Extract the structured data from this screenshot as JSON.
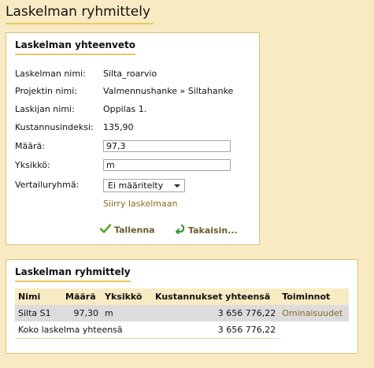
{
  "page": {
    "title": "Laskelman ryhmittely"
  },
  "summary": {
    "title": "Laskelman yhteenveto",
    "fields": {
      "name": {
        "label": "Laskelman nimi:",
        "value": "Silta_roarvio"
      },
      "project": {
        "label": "Projektin nimi:",
        "value": "Valmennushanke » Siltahanke"
      },
      "calculator": {
        "label": "Laskijan nimi:",
        "value": "Oppilas 1."
      },
      "index": {
        "label": "Kustannusindeksi:",
        "value": "135,90"
      },
      "amount": {
        "label": "Määrä:",
        "value": "97,3"
      },
      "unit": {
        "label": "Yksikkö:",
        "value": "m"
      },
      "group": {
        "label": "Vertailuryhmä:",
        "value": "Ei määritelty"
      }
    },
    "goto_link": "Siirry laskelmaan",
    "save_label": "Tallenna",
    "back_label": "Takaisin..."
  },
  "grouping": {
    "title": "Laskelman ryhmittely",
    "headers": {
      "name": "Nimi",
      "amount": "Määrä",
      "unit": "Yksikkö",
      "total": "Kustannukset yhteensä",
      "actions": "Toiminnot"
    },
    "rows": [
      {
        "name": "Silta S1",
        "amount": "97,30",
        "unit": "m",
        "total": "3 656 776,22",
        "action": "Ominaisuudet"
      }
    ],
    "total_row": {
      "label": "Koko laskelma yhteensä",
      "total": "3 656 776,22"
    }
  },
  "colors": {
    "background": "#f8ebc4",
    "accent_underline": "#e8c860",
    "link": "#8a6a1e",
    "save_icon": "#5aa52a",
    "back_icon": "#3a9a3a"
  }
}
